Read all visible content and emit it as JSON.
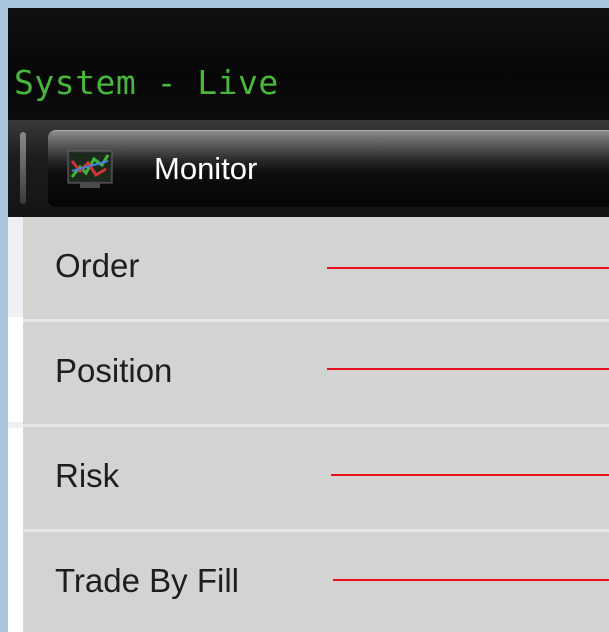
{
  "window": {
    "title": "System - Live"
  },
  "menubar": {
    "monitor": {
      "label": "Monitor",
      "icon": "chart-monitor-icon"
    }
  },
  "submenu": {
    "items": [
      {
        "label": "Order"
      },
      {
        "label": "Position"
      },
      {
        "label": "Risk"
      },
      {
        "label": "Trade By Fill"
      }
    ]
  },
  "colors": {
    "title_text": "#48b83c",
    "menu_item_bg": "#d3d3d1",
    "annotation_line": "#e8101c"
  }
}
